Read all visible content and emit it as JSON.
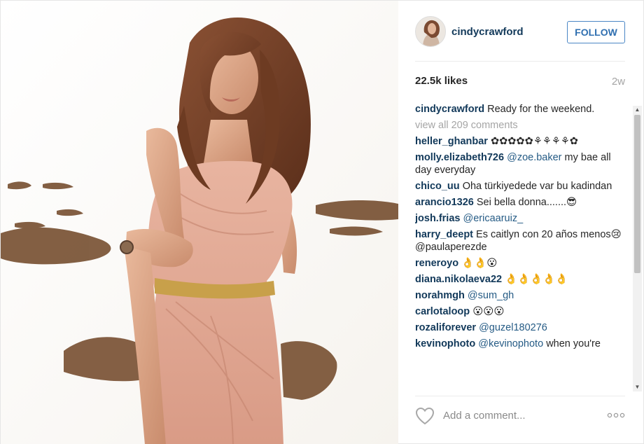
{
  "header": {
    "username": "cindycrawford",
    "follow_label": "FOLLOW",
    "avatar_icon": "profile-photo"
  },
  "stats": {
    "likes": "22.5k likes",
    "age": "2w"
  },
  "caption": {
    "user": "cindycrawford",
    "text": "Ready for the weekend."
  },
  "view_all": "view all 209 comments",
  "comments": [
    {
      "user": "heller_ghanbar",
      "mention": "",
      "text": "✿✿✿✿✿⚘⚘⚘⚘✿"
    },
    {
      "user": "molly.elizabeth726",
      "mention": "@zoe.baker",
      "text": "my bae all day everyday"
    },
    {
      "user": "chico_uu",
      "mention": "",
      "text": "Oha türkiyedede var bu kadindan"
    },
    {
      "user": "arancio1326",
      "mention": "",
      "text": "Sei bella donna.......😎"
    },
    {
      "user": "josh.frias",
      "mention": "@ericaaruiz_",
      "text": ""
    },
    {
      "user": "harry_deept",
      "mention": "",
      "text": "Es caitlyn con 20 años menos😢 @paulaperezde"
    },
    {
      "user": "reneroyo",
      "mention": "",
      "text": "👌👌😮"
    },
    {
      "user": "diana.nikolaeva22",
      "mention": "",
      "text": "👌👌👌👌👌"
    },
    {
      "user": "norahmgh",
      "mention": "@sum_gh",
      "text": ""
    },
    {
      "user": "carlotaloop",
      "mention": "",
      "text": "😮😮😮"
    },
    {
      "user": "rozaliforever",
      "mention": "@guzel180276",
      "text": ""
    },
    {
      "user": "kevinophoto",
      "mention": "@kevinophoto",
      "text": "when you're"
    }
  ],
  "footer": {
    "placeholder": "Add a comment...",
    "like_icon": "heart-outline-icon",
    "more_icon": "more-options-icon"
  },
  "colors": {
    "username": "#12395a",
    "follow_border": "#4a86c5",
    "muted": "#a5a5a5"
  }
}
